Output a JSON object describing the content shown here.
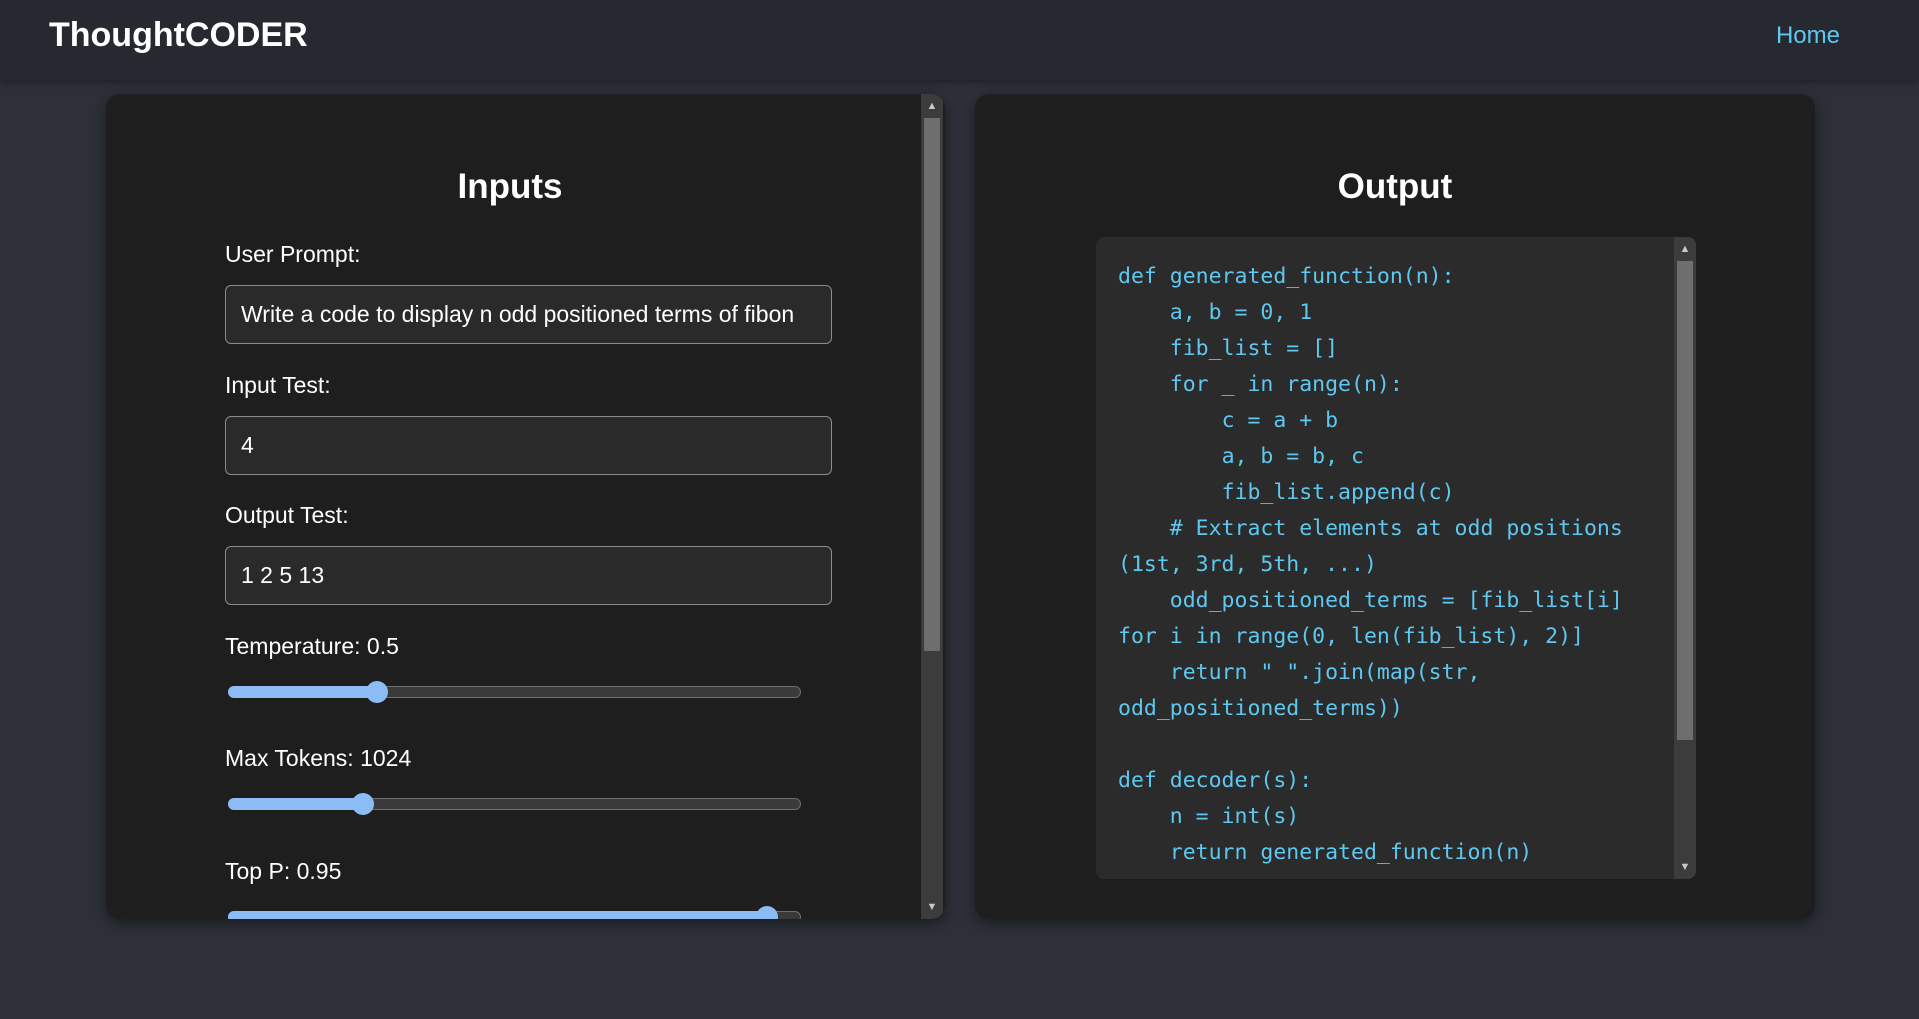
{
  "app": {
    "brand": "ThoughtCODER",
    "nav_home": "Home"
  },
  "inputs": {
    "title": "Inputs",
    "user_prompt_label": "User Prompt:",
    "user_prompt_value": "Write a code to display n odd positioned terms of fibon",
    "input_test_label": "Input Test:",
    "input_test_value": "4",
    "output_test_label": "Output Test:",
    "output_test_value": "1 2 5 13",
    "temperature_label": "Temperature: 0.5",
    "temperature_fraction": 0.26,
    "max_tokens_label": "Max Tokens: 1024",
    "max_tokens_fraction": 0.236,
    "top_p_label": "Top P: 0.95",
    "top_p_fraction": 0.94
  },
  "output": {
    "title": "Output",
    "code": "def generated_function(n):\n    a, b = 0, 1\n    fib_list = []\n    for _ in range(n):\n        c = a + b\n        a, b = b, c\n        fib_list.append(c)\n    # Extract elements at odd positions (1st, 3rd, 5th, ...)\n    odd_positioned_terms = [fib_list[i] for i in range(0, len(fib_list), 2)]\n    return \" \".join(map(str, odd_positioned_terms))\n\ndef decoder(s):\n    n = int(s)\n    return generated_function(n)"
  },
  "colors": {
    "page_bg": "#2d3039",
    "navbar_bg": "#262930",
    "card_bg": "#1e1e1e",
    "accent": "#5ec8f0",
    "slider": "#8cbcf5"
  },
  "icons": {
    "scroll_up": "▲",
    "scroll_down": "▼"
  }
}
